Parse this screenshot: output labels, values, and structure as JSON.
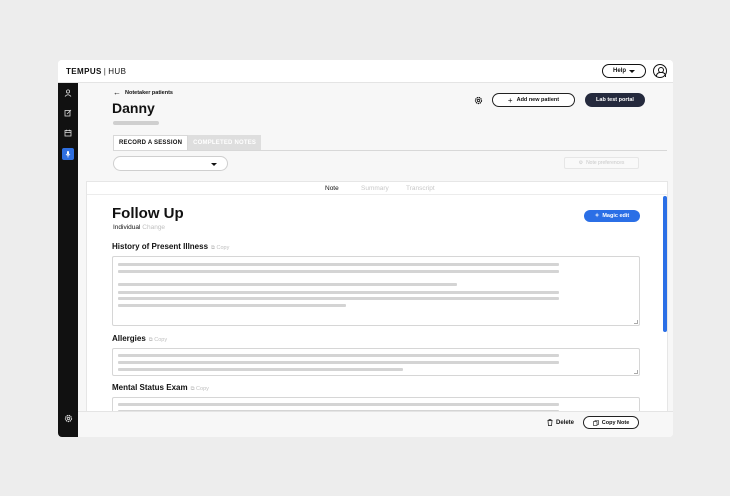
{
  "header": {
    "brand": "TEMPUS",
    "brand_sep": "|",
    "brand_product": "HUB",
    "help_label": "Help"
  },
  "sidebar": {
    "icons": [
      "person-icon",
      "edit-icon",
      "calendar-icon",
      "microphone-icon",
      "settings-icon"
    ],
    "active": "microphone-icon"
  },
  "patient": {
    "back_label": "Notetaker patients",
    "name": "Danny",
    "add_patient_label": "Add new patient",
    "lab_portal_label": "Lab test portal"
  },
  "session_tabs": [
    {
      "label": "RECORD A SESSION",
      "active": true
    },
    {
      "label": "COMPLETED NOTES",
      "active": false
    }
  ],
  "toolbar": {
    "note_preferences_label": "Note preferences"
  },
  "note_tabs": [
    {
      "label": "Note",
      "active": true
    },
    {
      "label": "Summary",
      "active": false
    },
    {
      "label": "Transcript",
      "active": false
    }
  ],
  "note": {
    "title": "Follow Up",
    "subtitle": "Individual",
    "change_label": "Change",
    "magic_edit_label": "Magic edit",
    "copy_label": "Copy",
    "sections": [
      {
        "heading": "History of Present Illness"
      },
      {
        "heading": "Allergies"
      },
      {
        "heading": "Mental Status Exam"
      }
    ]
  },
  "footer": {
    "delete_label": "Delete",
    "copy_note_label": "Copy Note"
  },
  "colors": {
    "accent": "#2b6fe6",
    "sidebar": "#111111",
    "lab_button": "#252a3d"
  }
}
